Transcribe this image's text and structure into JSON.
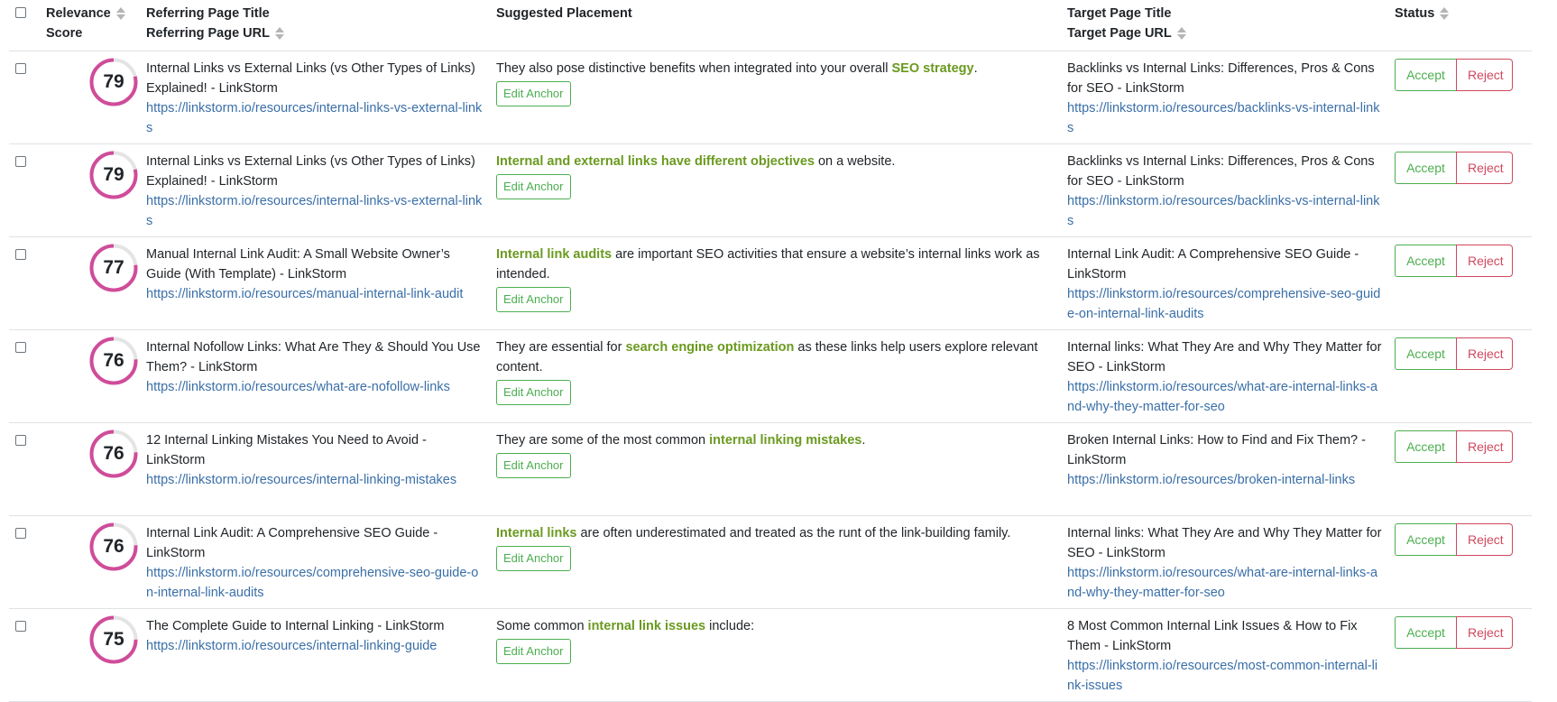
{
  "colors": {
    "score_ring": "#d04c9a",
    "score_track": "#e4e4e4",
    "highlight": "#6a9a1f",
    "url": "#3a6fa8",
    "accept": "#4caf50",
    "reject": "#d0485e"
  },
  "header": {
    "score_line1": "Relevance",
    "score_line2": "Score",
    "ref_line1": "Referring Page Title",
    "ref_line2": "Referring Page URL",
    "suggested": "Suggested Placement",
    "target_line1": "Target Page Title",
    "target_line2": "Target Page URL",
    "status": "Status"
  },
  "labels": {
    "edit_anchor": "Edit Anchor",
    "accept": "Accept",
    "reject": "Reject"
  },
  "rows": [
    {
      "score": 79,
      "ref_title": "Internal Links vs External Links (vs Other Types of Links) Explained! - LinkStorm",
      "ref_url": "https://linkstorm.io/resources/internal-links-vs-external-links",
      "sug_before": "They also pose distinctive benefits when integrated into your overall ",
      "sug_anchor": "SEO strategy",
      "sug_after": ".",
      "tgt_title": "Backlinks vs Internal Links: Differences, Pros & Cons for SEO - LinkStorm",
      "tgt_url": "https://linkstorm.io/resources/backlinks-vs-internal-links"
    },
    {
      "score": 79,
      "ref_title": "Internal Links vs External Links (vs Other Types of Links) Explained! - LinkStorm",
      "ref_url": "https://linkstorm.io/resources/internal-links-vs-external-links",
      "sug_before": "",
      "sug_anchor": "Internal and external links have different objectives",
      "sug_after": " on a website.",
      "tgt_title": "Backlinks vs Internal Links: Differences, Pros & Cons for SEO - LinkStorm",
      "tgt_url": "https://linkstorm.io/resources/backlinks-vs-internal-links"
    },
    {
      "score": 77,
      "ref_title": "Manual Internal Link Audit: A Small Website Owner’s Guide (With Template) - LinkStorm",
      "ref_url": "https://linkstorm.io/resources/manual-internal-link-audit",
      "sug_before": "",
      "sug_anchor": "Internal link audits",
      "sug_after": " are important SEO activities that ensure a website’s internal links work as intended.",
      "tgt_title": "Internal Link Audit: A Comprehensive SEO Guide - LinkStorm",
      "tgt_url": "https://linkstorm.io/resources/comprehensive-seo-guide-on-internal-link-audits"
    },
    {
      "score": 76,
      "ref_title": "Internal Nofollow Links: What Are They & Should You Use Them? - LinkStorm",
      "ref_url": "https://linkstorm.io/resources/what-are-nofollow-links",
      "sug_before": "They are essential for ",
      "sug_anchor": "search engine optimization",
      "sug_after": " as these links help users explore relevant content.",
      "tgt_title": "Internal links: What They Are and Why They Matter for SEO - LinkStorm",
      "tgt_url": "https://linkstorm.io/resources/what-are-internal-links-and-why-they-matter-for-seo"
    },
    {
      "score": 76,
      "ref_title": "12 Internal Linking Mistakes You Need to Avoid - LinkStorm",
      "ref_url": "https://linkstorm.io/resources/internal-linking-mistakes",
      "sug_before": "They are some of the most common ",
      "sug_anchor": "internal linking mistakes",
      "sug_after": ".",
      "tgt_title": "Broken Internal Links: How to Find and Fix Them? - LinkStorm",
      "tgt_url": "https://linkstorm.io/resources/broken-internal-links"
    },
    {
      "score": 76,
      "ref_title": "Internal Link Audit: A Comprehensive SEO Guide - LinkStorm",
      "ref_url": "https://linkstorm.io/resources/comprehensive-seo-guide-on-internal-link-audits",
      "sug_before": "",
      "sug_anchor": "Internal links",
      "sug_after": " are often underestimated and treated as the runt of the link-building family.",
      "tgt_title": "Internal links: What They Are and Why They Matter for SEO - LinkStorm",
      "tgt_url": "https://linkstorm.io/resources/what-are-internal-links-and-why-they-matter-for-seo"
    },
    {
      "score": 75,
      "ref_title": "The Complete Guide to Internal Linking - LinkStorm",
      "ref_url": "https://linkstorm.io/resources/internal-linking-guide",
      "sug_before": "Some common ",
      "sug_anchor": "internal link issues",
      "sug_after": " include:",
      "tgt_title": "8 Most Common Internal Link Issues & How to Fix Them - LinkStorm",
      "tgt_url": "https://linkstorm.io/resources/most-common-internal-link-issues"
    }
  ]
}
